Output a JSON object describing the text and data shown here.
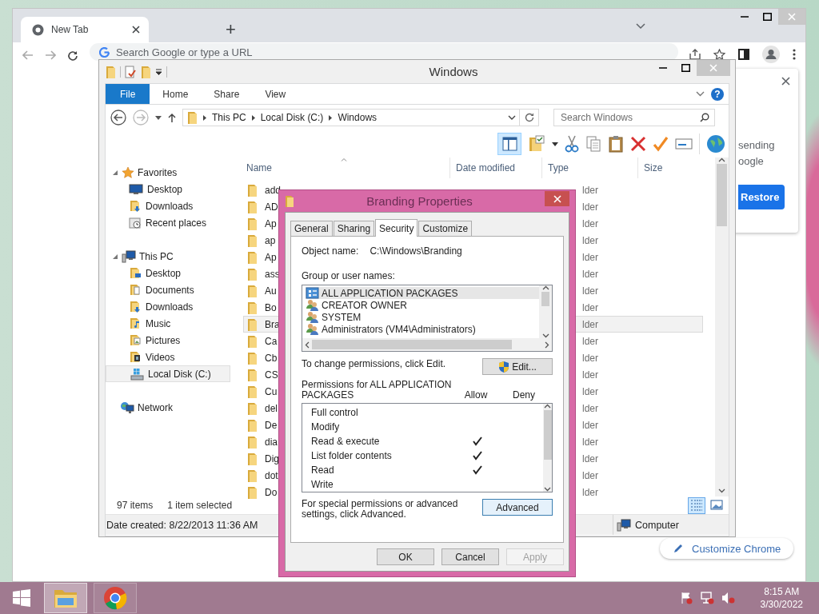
{
  "browser": {
    "tabs": [
      {
        "label": "New Tab",
        "selected": true
      }
    ],
    "new_tab": "+",
    "omnibox": {
      "placeholder": "Search Google or type a URL"
    },
    "popup": {
      "lines": [
        "sending",
        "oogle"
      ],
      "button": "Restore"
    },
    "customize_button": "Customize Chrome"
  },
  "explorer": {
    "title": "Windows",
    "ribbon_tabs": [
      {
        "label": "File",
        "kind": "file"
      },
      {
        "label": "Home",
        "kind": "tab"
      },
      {
        "label": "Share",
        "kind": "tab"
      },
      {
        "label": "View",
        "kind": "tab"
      }
    ],
    "help": "?",
    "breadcrumb": [
      "This PC",
      "Local Disk (C:)",
      "Windows"
    ],
    "search": {
      "placeholder": "Search Windows"
    },
    "nav": [
      {
        "label": "Favorites",
        "kind": "star",
        "expanded": true,
        "selected": false,
        "children": [
          {
            "label": "Desktop",
            "kind": "monitor",
            "selected": false
          },
          {
            "label": "Downloads",
            "kind": "downloads",
            "selected": false
          },
          {
            "label": "Recent places",
            "kind": "recent",
            "selected": false
          }
        ]
      },
      {
        "label": "This PC",
        "kind": "pc",
        "expanded": true,
        "selected": false,
        "children": [
          {
            "label": "Desktop",
            "kind": "desktop-folder",
            "selected": false
          },
          {
            "label": "Documents",
            "kind": "documents",
            "selected": false
          },
          {
            "label": "Downloads",
            "kind": "downloads",
            "selected": false
          },
          {
            "label": "Music",
            "kind": "music",
            "selected": false
          },
          {
            "label": "Pictures",
            "kind": "pictures",
            "selected": false
          },
          {
            "label": "Videos",
            "kind": "videos",
            "selected": false
          },
          {
            "label": "Local Disk (C:)",
            "kind": "disk",
            "selected": true
          }
        ]
      },
      {
        "label": "Network",
        "kind": "network",
        "selected": false
      }
    ],
    "columns": [
      "Name",
      "Date modified",
      "Type",
      "Size"
    ],
    "rows": [
      {
        "name": "add",
        "type": "lder",
        "selected": false
      },
      {
        "name": "AD",
        "type": "lder",
        "selected": false
      },
      {
        "name": "Ap",
        "type": "lder",
        "selected": false
      },
      {
        "name": "ap",
        "type": "lder",
        "selected": false
      },
      {
        "name": "Ap",
        "type": "lder",
        "selected": false
      },
      {
        "name": "ass",
        "type": "lder",
        "selected": false
      },
      {
        "name": "Au",
        "type": "lder",
        "selected": false
      },
      {
        "name": "Bo",
        "type": "lder",
        "selected": false
      },
      {
        "name": "Bra",
        "type": "lder",
        "selected": true
      },
      {
        "name": "Ca",
        "type": "lder",
        "selected": false
      },
      {
        "name": "Cb",
        "type": "lder",
        "selected": false
      },
      {
        "name": "CS",
        "type": "lder",
        "selected": false
      },
      {
        "name": "Cu",
        "type": "lder",
        "selected": false
      },
      {
        "name": "del",
        "type": "lder",
        "selected": false
      },
      {
        "name": "De",
        "type": "lder",
        "selected": false
      },
      {
        "name": "dia",
        "type": "lder",
        "selected": false
      },
      {
        "name": "Dig",
        "type": "lder",
        "selected": false
      },
      {
        "name": "dot",
        "type": "lder",
        "selected": false
      },
      {
        "name": "Do",
        "type": "lder",
        "selected": false
      }
    ],
    "item_count": "97 items",
    "selection": "1 item selected",
    "views": [
      {
        "kind": "details",
        "selected": true
      },
      {
        "kind": "large-icons",
        "selected": false
      }
    ],
    "details": "Date created: 8/22/2013 11:36 AM",
    "location": "Computer"
  },
  "dialog": {
    "title": "Branding Properties",
    "tabs": [
      {
        "label": "General",
        "selected": false
      },
      {
        "label": "Sharing",
        "selected": false
      },
      {
        "label": "Security",
        "selected": true
      },
      {
        "label": "Customize",
        "selected": false
      }
    ],
    "object_label": "Object name:",
    "object_value": "C:\\Windows\\Branding",
    "users_label": "Group or user names:",
    "users": [
      {
        "name": "ALL APPLICATION PACKAGES",
        "kind": "package",
        "selected": true
      },
      {
        "name": "CREATOR OWNER",
        "kind": "group",
        "selected": false
      },
      {
        "name": "SYSTEM",
        "kind": "group",
        "selected": false
      },
      {
        "name": "Administrators (VM4\\Administrators)",
        "kind": "group",
        "selected": false
      }
    ],
    "edit_hint": "To change permissions, click Edit.",
    "edit_button": "Edit...",
    "permissions_label": "Permissions for ALL APPLICATION PACKAGES",
    "allow_label": "Allow",
    "deny_label": "Deny",
    "permissions": [
      {
        "name": "Full control",
        "allow": false,
        "deny": false
      },
      {
        "name": "Modify",
        "allow": false,
        "deny": false
      },
      {
        "name": "Read & execute",
        "allow": true,
        "deny": false
      },
      {
        "name": "List folder contents",
        "allow": true,
        "deny": false
      },
      {
        "name": "Read",
        "allow": true,
        "deny": false
      },
      {
        "name": "Write",
        "allow": false,
        "deny": false
      }
    ],
    "advanced_hint": "For special permissions or advanced settings, click Advanced.",
    "advanced_button": "Advanced",
    "buttons": [
      {
        "label": "OK",
        "disabled": false
      },
      {
        "label": "Cancel",
        "disabled": false
      },
      {
        "label": "Apply",
        "disabled": true
      }
    ]
  },
  "taskbar": {
    "apps": [
      {
        "kind": "explorer",
        "selected": true
      },
      {
        "kind": "browser",
        "selected": false
      }
    ],
    "time": "8:15 AM",
    "date": "3/30/2022"
  }
}
